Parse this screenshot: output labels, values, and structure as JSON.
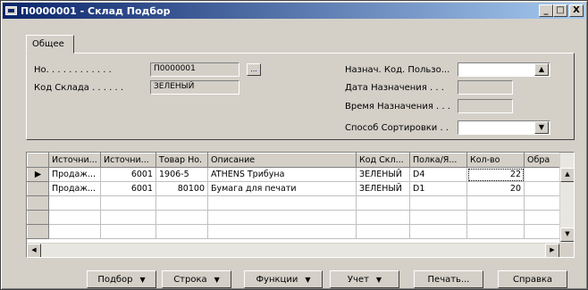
{
  "window": {
    "title": "П0000001 - Склад Подбор",
    "controls": {
      "minimize": "_",
      "maximize": "□",
      "close": "X"
    }
  },
  "tabs": [
    {
      "label": "Общее"
    }
  ],
  "fields": {
    "no_label": "Но. . . . . . . . . . . .",
    "no_value": "П0000001",
    "location_label": "Код Склада . . . . . .",
    "location_value": "ЗЕЛЕНЫЙ",
    "assigned_user_label": "Назнач. Код. Пользо...",
    "assigned_user_value": "",
    "assign_date_label": "Дата Назначения . . .",
    "assign_date_value": "",
    "assign_time_label": "Время Назначения . . .",
    "assign_time_value": "",
    "sort_method_label": "Способ Сортировки . .",
    "sort_method_value": ""
  },
  "grid": {
    "columns": [
      "Источни...",
      "Источни...",
      "Товар Но.",
      "Описание",
      "Код Скл...",
      "Полка/Я...",
      "Кол-во",
      "Обра"
    ],
    "rows": [
      [
        "Продаж...",
        "6001",
        "1906-5",
        "ATHENS Трибуна",
        "ЗЕЛЕНЫЙ",
        "D4",
        "22",
        ""
      ],
      [
        "Продаж...",
        "6001",
        "80100",
        "Бумага для печати",
        "ЗЕЛЕНЫЙ",
        "D1",
        "20",
        ""
      ]
    ],
    "current_row_marker": "▶"
  },
  "buttons": {
    "pick": "Подбор",
    "line": "Строка",
    "functions": "Функции",
    "posting": "Учет",
    "print": "Печать...",
    "help": "Справка"
  },
  "icons": {
    "dropdown": "▼",
    "lookup": "...",
    "scroll_left": "◀",
    "scroll_right": "▶",
    "scroll_up": "▲",
    "scroll_down": "▼"
  },
  "colors": {
    "titlebar_start": "#0a246a",
    "titlebar_end": "#a6caf0",
    "window_face": "#d4d0c8"
  }
}
